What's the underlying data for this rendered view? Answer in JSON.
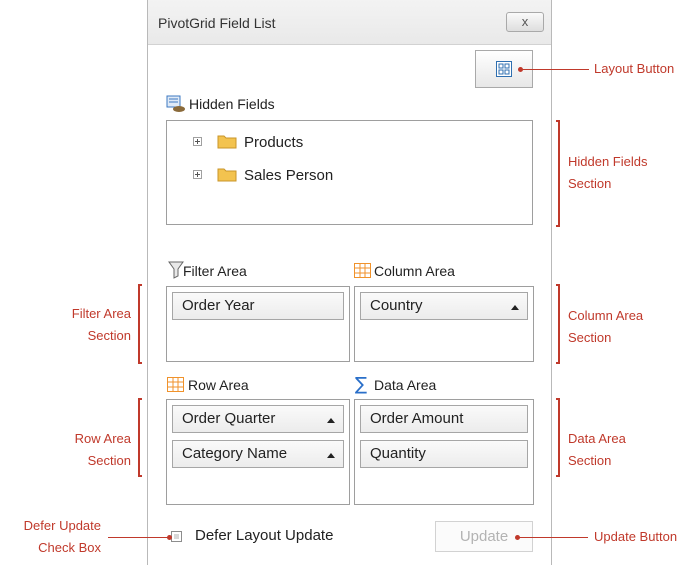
{
  "window": {
    "title": "PivotGrid Field List",
    "close_label": "x"
  },
  "hidden_fields": {
    "header": "Hidden Fields",
    "items": [
      {
        "label": "Products"
      },
      {
        "label": "Sales Person"
      }
    ]
  },
  "filter_area": {
    "header": "Filter Area",
    "fields": [
      "Order Year"
    ]
  },
  "column_area": {
    "header": "Column Area",
    "fields": [
      "Country"
    ]
  },
  "row_area": {
    "header": "Row Area",
    "fields": [
      "Order Quarter",
      "Category Name"
    ]
  },
  "data_area": {
    "header": "Data Area",
    "icon_glyph": "∑",
    "fields": [
      "Order Amount",
      "Quantity"
    ]
  },
  "footer": {
    "defer_label": "Defer Layout Update",
    "defer_checked": false,
    "update_label": "Update",
    "update_enabled": false
  },
  "callouts": {
    "layout_button": "Layout Button",
    "hidden_fields_section": [
      "Hidden Fields",
      "Section"
    ],
    "filter_area_section": [
      "Filter Area",
      "Section"
    ],
    "column_area_section": [
      "Column Area",
      "Section"
    ],
    "row_area_section": [
      "Row Area",
      "Section"
    ],
    "data_area_section": [
      "Data Area",
      "Section"
    ],
    "defer_update_check_box": [
      "Defer Update",
      "Check Box"
    ],
    "update_button": "Update Button"
  },
  "colors": {
    "callout": "#c0392b",
    "folder": "#f3c34f",
    "grid_icon": "#f0922b",
    "sigma": "#2a6fc9"
  }
}
